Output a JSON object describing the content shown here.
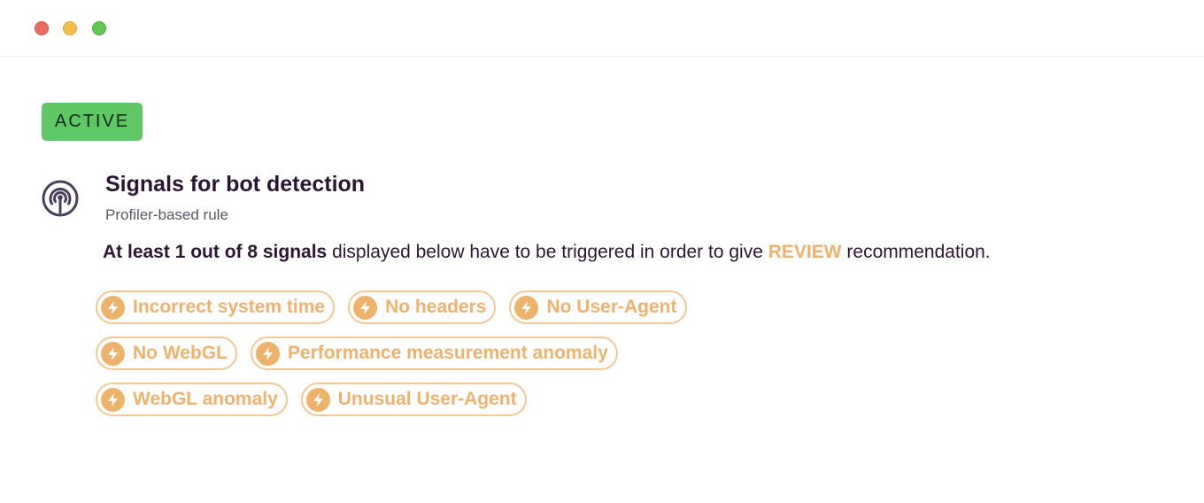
{
  "window": {
    "controls": [
      "close",
      "minimize",
      "maximize"
    ]
  },
  "status": {
    "badge": "ACTIVE",
    "color": "#5fc766"
  },
  "rule": {
    "icon": "broadcast-signal-icon",
    "title": "Signals for bot detection",
    "subtitle": "Profiler-based rule",
    "description": {
      "strong": "At least 1 out of 8 signals",
      "middle": " displayed below have to be triggered in order to give ",
      "recommendation": "REVIEW",
      "end": " recommendation."
    },
    "accent_color": "#eeb26a",
    "signals": [
      {
        "icon": "lightning-bolt-icon",
        "label": "Incorrect system time"
      },
      {
        "icon": "lightning-bolt-icon",
        "label": "No headers"
      },
      {
        "icon": "lightning-bolt-icon",
        "label": "No User-Agent"
      },
      {
        "icon": "lightning-bolt-icon",
        "label": "No WebGL"
      },
      {
        "icon": "lightning-bolt-icon",
        "label": "Performance measurement anomaly"
      },
      {
        "icon": "lightning-bolt-icon",
        "label": "WebGL anomaly"
      },
      {
        "icon": "lightning-bolt-icon",
        "label": "Unusual User-Agent"
      }
    ]
  }
}
